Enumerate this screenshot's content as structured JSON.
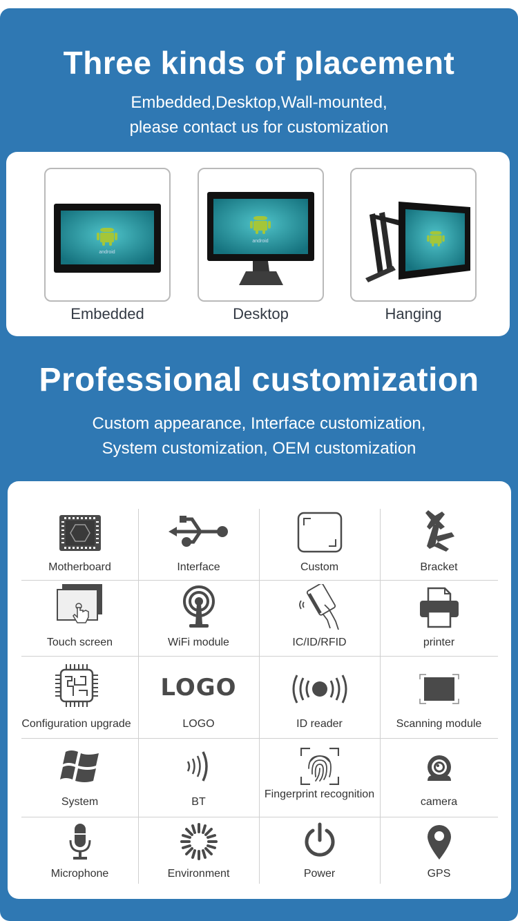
{
  "colors": {
    "background_blue": "#2f78b3",
    "panel": "#ffffff",
    "icon_gray": "#4a4a4a",
    "android_green": "#a4c639",
    "screen_teal": "#1f8f9a"
  },
  "placement": {
    "title": "Three kinds of placement",
    "subtitle_line1": "Embedded,Desktop,Wall-mounted,",
    "subtitle_line2": "please contact us for customization",
    "items": [
      {
        "label": "Embedded",
        "image": "embedded-panel-pc"
      },
      {
        "label": "Desktop",
        "image": "desktop-stand-pc"
      },
      {
        "label": "Hanging",
        "image": "wall-arm-mounted-pc"
      }
    ],
    "screen_text": "android"
  },
  "customization": {
    "title": "Professional customization",
    "subtitle_line1": "Custom appearance, Interface customization,",
    "subtitle_line2": "System customization, OEM customization",
    "logo_glyph": "LOGO",
    "features": [
      {
        "label": "Motherboard",
        "icon": "motherboard-icon"
      },
      {
        "label": "Interface",
        "icon": "usb-icon"
      },
      {
        "label": "Custom",
        "icon": "custom-frame-icon"
      },
      {
        "label": "Bracket",
        "icon": "bracket-icon"
      },
      {
        "label": "Touch screen",
        "icon": "touch-screen-icon"
      },
      {
        "label": "WiFi module",
        "icon": "wifi-antenna-icon"
      },
      {
        "label": "IC/ID/RFID",
        "icon": "rfid-card-icon"
      },
      {
        "label": "printer",
        "icon": "printer-icon"
      },
      {
        "label": "Configuration upgrade",
        "icon": "chip-icon"
      },
      {
        "label": "LOGO",
        "icon": "logo-icon"
      },
      {
        "label": "ID reader",
        "icon": "id-reader-icon"
      },
      {
        "label": "Scanning module",
        "icon": "scanner-icon"
      },
      {
        "label": "System",
        "icon": "windows-icon"
      },
      {
        "label": "BT",
        "icon": "bluetooth-waves-icon"
      },
      {
        "label": "Fingerprint recognition",
        "icon": "fingerprint-icon"
      },
      {
        "label": "camera",
        "icon": "camera-icon"
      },
      {
        "label": "Microphone",
        "icon": "microphone-icon"
      },
      {
        "label": "Environment",
        "icon": "environment-icon"
      },
      {
        "label": "Power",
        "icon": "power-icon"
      },
      {
        "label": "GPS",
        "icon": "gps-pin-icon"
      }
    ]
  }
}
